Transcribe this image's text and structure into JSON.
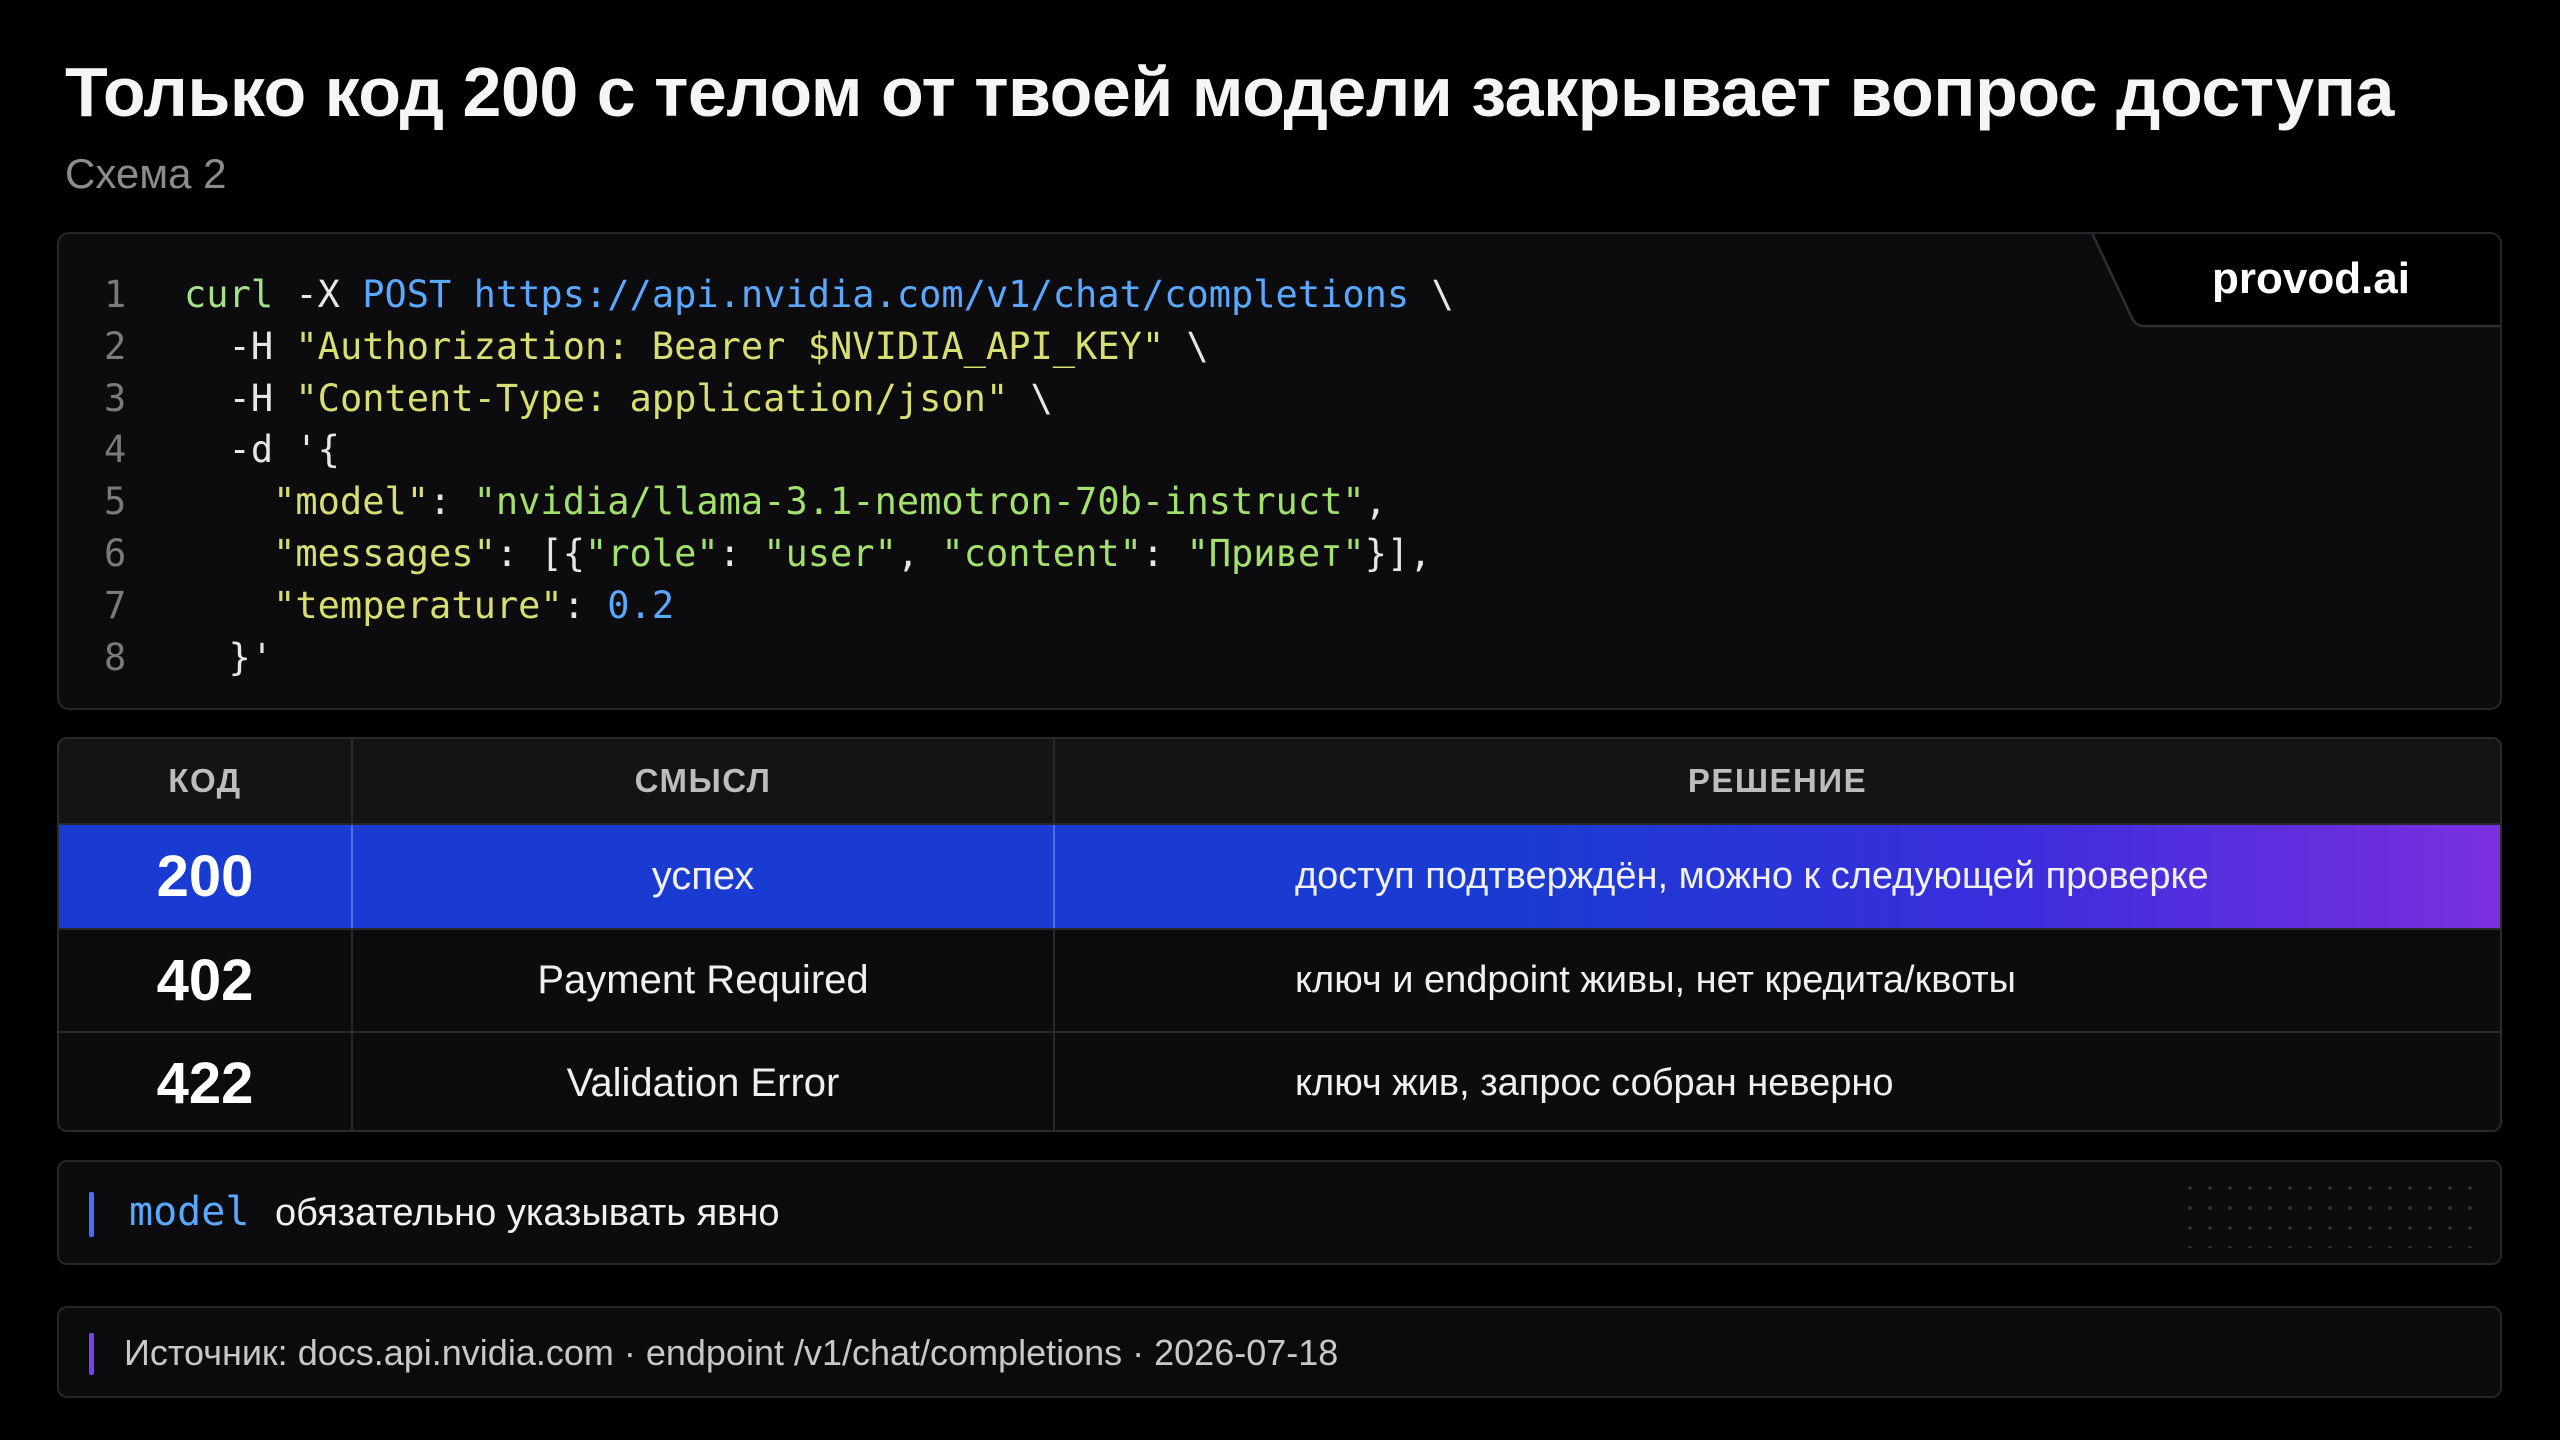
{
  "header": {
    "title": "Только код 200 с телом от твоей модели закрывает вопрос доступа",
    "subtitle": "Схема 2"
  },
  "brand": "provod.ai",
  "code": {
    "lines": [
      {
        "num": "1",
        "tokens": [
          {
            "t": "curl",
            "k": "cmd"
          },
          {
            "t": " -X ",
            "k": "plain"
          },
          {
            "t": "POST",
            "k": "key"
          },
          {
            "t": " ",
            "k": "plain"
          },
          {
            "t": "https://api.nvidia.com/v1/chat/completions",
            "k": "url"
          },
          {
            "t": " \\",
            "k": "plain"
          }
        ]
      },
      {
        "num": "2",
        "tokens": [
          {
            "t": "  -H ",
            "k": "plain"
          },
          {
            "t": "\"Authorization: Bearer $NVIDIA_API_KEY\"",
            "k": "str"
          },
          {
            "t": " \\",
            "k": "plain"
          }
        ]
      },
      {
        "num": "3",
        "tokens": [
          {
            "t": "  -H ",
            "k": "plain"
          },
          {
            "t": "\"Content-Type: application/json\"",
            "k": "str"
          },
          {
            "t": " \\",
            "k": "plain"
          }
        ]
      },
      {
        "num": "4",
        "tokens": [
          {
            "t": "  -d '{",
            "k": "plain"
          }
        ]
      },
      {
        "num": "5",
        "tokens": [
          {
            "t": "    ",
            "k": "plain"
          },
          {
            "t": "\"model\"",
            "k": "prop"
          },
          {
            "t": ": ",
            "k": "plain"
          },
          {
            "t": "\"nvidia/llama-3.1-nemotron-70b-instruct\"",
            "k": "val"
          },
          {
            "t": ",",
            "k": "plain"
          }
        ]
      },
      {
        "num": "6",
        "tokens": [
          {
            "t": "    ",
            "k": "plain"
          },
          {
            "t": "\"messages\"",
            "k": "prop"
          },
          {
            "t": ": [{",
            "k": "plain"
          },
          {
            "t": "\"role\"",
            "k": "val"
          },
          {
            "t": ": ",
            "k": "plain"
          },
          {
            "t": "\"user\"",
            "k": "val"
          },
          {
            "t": ", ",
            "k": "plain"
          },
          {
            "t": "\"content\"",
            "k": "val"
          },
          {
            "t": ": ",
            "k": "plain"
          },
          {
            "t": "\"Привет\"",
            "k": "val"
          },
          {
            "t": "}],",
            "k": "plain"
          }
        ]
      },
      {
        "num": "7",
        "tokens": [
          {
            "t": "    ",
            "k": "plain"
          },
          {
            "t": "\"temperature\"",
            "k": "prop"
          },
          {
            "t": ": ",
            "k": "plain"
          },
          {
            "t": "0.2",
            "k": "num"
          }
        ]
      },
      {
        "num": "8",
        "tokens": [
          {
            "t": "  }'",
            "k": "plain"
          }
        ]
      }
    ]
  },
  "table": {
    "headers": [
      "КОД",
      "СМЫСЛ",
      "РЕШЕНИЕ"
    ],
    "rows": [
      {
        "code": "200",
        "meaning": "успех",
        "decision": "доступ подтверждён, можно к следующей проверке",
        "highlighted": true
      },
      {
        "code": "402",
        "meaning": "Payment Required",
        "decision": "ключ и endpoint живы, нет кредита/квоты",
        "highlighted": false
      },
      {
        "code": "422",
        "meaning": "Validation Error",
        "decision": "ключ жив, запрос собран неверно",
        "highlighted": false
      }
    ]
  },
  "note": {
    "code": "model",
    "text": "обязательно указывать явно"
  },
  "source": {
    "text": "Источник: docs.api.nvidia.com · endpoint /v1/chat/completions · 2026-07-18"
  },
  "colors": {
    "highlight_start": "#1a3bd2",
    "highlight_end": "#7a2fe0",
    "note_accent": "#4a6cff",
    "source_accent": "#7a3ff0"
  }
}
